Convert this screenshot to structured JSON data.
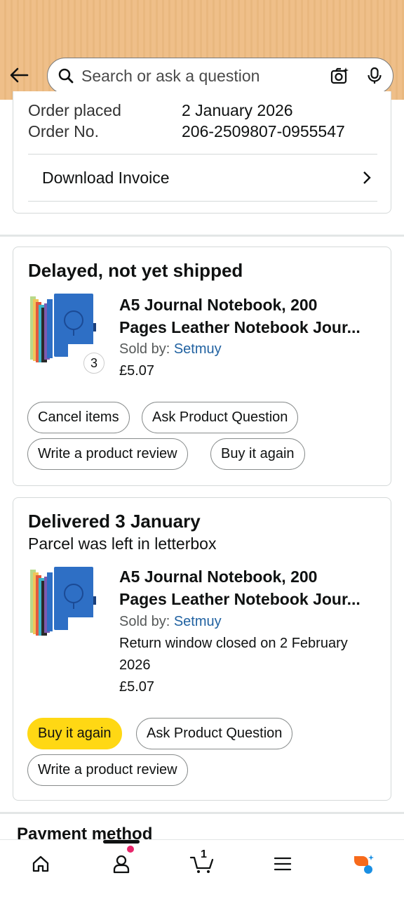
{
  "search": {
    "placeholder": "Search or ask a question"
  },
  "order": {
    "placed_label": "Order placed",
    "placed_value": "2 January 2026",
    "number_label": "Order No.",
    "number_value": "206-2509807-0955547",
    "invoice_label": "Download Invoice"
  },
  "shipment1": {
    "status": "Delayed, not yet shipped",
    "qty": "3",
    "title_line1": "A5 Journal Notebook, 200",
    "title_line2": "Pages Leather Notebook Jour...",
    "sold_by_label": "Sold by:",
    "seller": "Setmuy",
    "price": "£5.07",
    "buttons": [
      "Cancel items",
      "Ask Product Question",
      "Write a product review",
      "Buy it again"
    ]
  },
  "shipment2": {
    "status": "Delivered 3 January",
    "substatus": "Parcel was left in letterbox",
    "title_line1": "A5 Journal Notebook, 200",
    "title_line2": "Pages Leather Notebook Jour...",
    "sold_by_label": "Sold by:",
    "seller": "Setmuy",
    "return_line1": "Return window closed on 2 February",
    "return_line2": "2026",
    "price": "£5.07",
    "buttons": [
      "Buy it again",
      "Ask Product Question",
      "Write a product review"
    ]
  },
  "payment": {
    "heading": "Payment method"
  },
  "nav": {
    "items": [
      "home-icon",
      "account-icon",
      "cart-icon",
      "menu-icon",
      "rufus-icon"
    ],
    "cart_count": "1"
  },
  "colors": {
    "header": "#efbf89",
    "accent_yellow": "#ffd814",
    "link": "#2162a1",
    "notification": "#e8266b"
  }
}
